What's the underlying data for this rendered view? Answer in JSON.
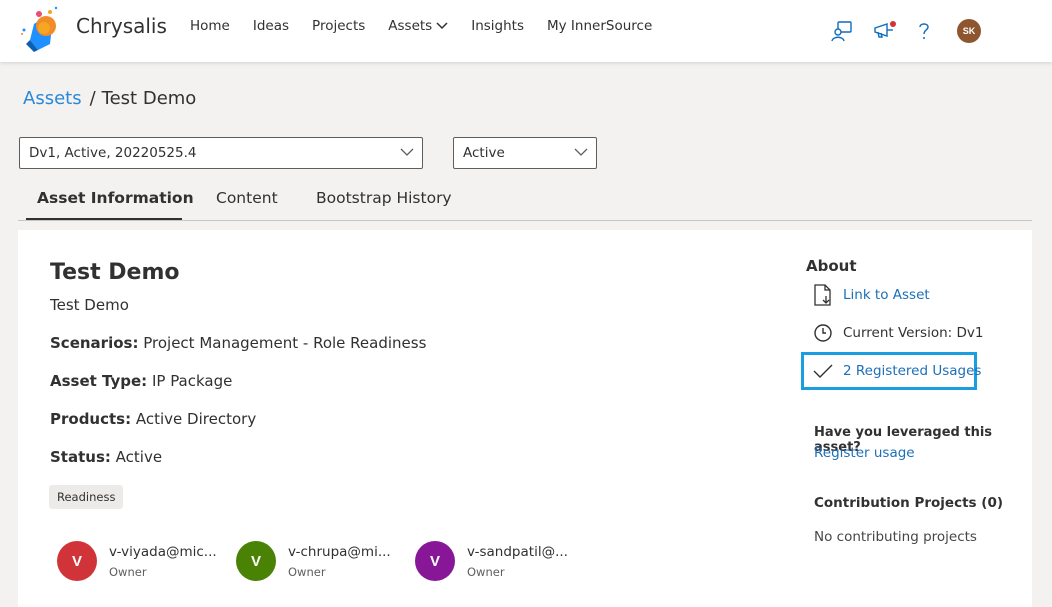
{
  "app": {
    "brand": "Chrysalis",
    "nav": [
      "Home",
      "Ideas",
      "Projects",
      "Assets",
      "Insights",
      "My InnerSource"
    ],
    "user_initials": "SK",
    "colors": {
      "accent": "#0f6cbd",
      "avatar_bg": "#8e562e",
      "highlight_border": "#1b9de2"
    }
  },
  "breadcrumb": {
    "root": "Assets",
    "separator": "/",
    "current": "Test Demo"
  },
  "filters": {
    "version": "Dv1, Active, 20220525.4",
    "status": "Active"
  },
  "tabs": [
    "Asset Information",
    "Content",
    "Bootstrap History"
  ],
  "asset": {
    "title": "Test Demo",
    "description": "Test Demo",
    "fields": [
      {
        "label": "Scenarios:",
        "value": "Project Management - Role Readiness"
      },
      {
        "label": "Asset Type:",
        "value": "IP Package"
      },
      {
        "label": "Products:",
        "value": "Active Directory"
      },
      {
        "label": "Status:",
        "value": "Active"
      }
    ],
    "tag": "Readiness",
    "owners": [
      {
        "initial": "V",
        "email": "v-viyada@mic...",
        "role": "Owner",
        "color": "#d13438"
      },
      {
        "initial": "V",
        "email": "v-chrupa@mi...",
        "role": "Owner",
        "color": "#498205"
      },
      {
        "initial": "V",
        "email": "v-sandpatil@...",
        "role": "Owner",
        "color": "#881798"
      }
    ]
  },
  "about": {
    "heading": "About",
    "link_to_asset": "Link to Asset",
    "current_version": "Current Version: Dv1",
    "registered_usages": "2 Registered Usages",
    "leverage_question": "Have you leveraged this asset?",
    "register_usage": "Register usage",
    "contribution_heading": "Contribution Projects (0)",
    "contribution_empty": "No contributing projects"
  }
}
